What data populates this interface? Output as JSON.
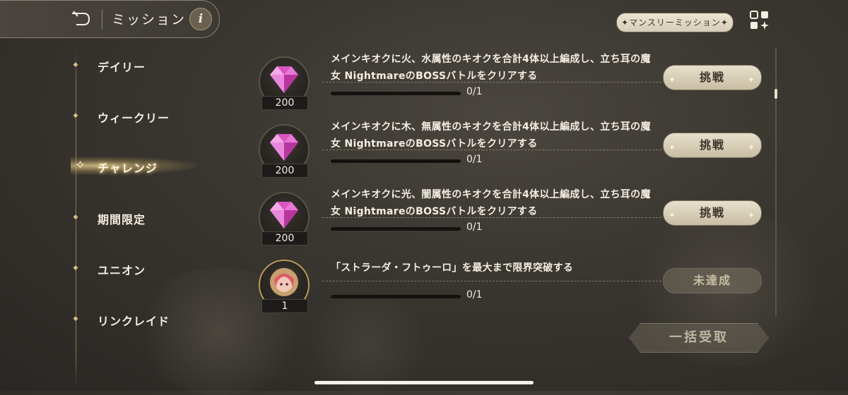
{
  "header": {
    "title": "ミッション",
    "info_label": "i",
    "monthly_label": "✦マンスリーミッション✦"
  },
  "sidebar": {
    "items": [
      {
        "label": "デイリー",
        "active": false
      },
      {
        "label": "ウィークリー",
        "active": false
      },
      {
        "label": "チャレンジ",
        "active": true
      },
      {
        "label": "期間限定",
        "active": false
      },
      {
        "label": "ユニオン",
        "active": false
      },
      {
        "label": "リンクレイド",
        "active": false
      }
    ]
  },
  "missions": [
    {
      "text": "メインキオクに火、水属性のキオクを合計4体以上編成し、立ち耳の魔女 NightmareのBOSSバトルをクリアする",
      "reward_count": "200",
      "reward_icon": "gem-icon",
      "progress": "0/1",
      "progress_fraction": 0,
      "button": "挑戦",
      "enabled": true
    },
    {
      "text": "メインキオクに木、無属性のキオクを合計4体以上編成し、立ち耳の魔女 NightmareのBOSSバトルをクリアする",
      "reward_count": "200",
      "reward_icon": "gem-icon",
      "progress": "0/1",
      "progress_fraction": 0,
      "button": "挑戦",
      "enabled": true
    },
    {
      "text": "メインキオクに光、闇属性のキオクを合計4体以上編成し、立ち耳の魔女 NightmareのBOSSバトルをクリアする",
      "reward_count": "200",
      "reward_icon": "gem-icon",
      "progress": "0/1",
      "progress_fraction": 0,
      "button": "挑戦",
      "enabled": true
    },
    {
      "text": "「ストラーダ・フトゥーロ」を最大まで限界突破する",
      "reward_count": "1",
      "reward_icon": "character-portrait-icon",
      "progress": "0/1",
      "progress_fraction": 0,
      "button": "未達成",
      "enabled": false
    }
  ],
  "bulk_button": "一括受取",
  "colors": {
    "accent": "#d8bf80",
    "button": "#e8e0cc",
    "gem": "#e060c8"
  }
}
